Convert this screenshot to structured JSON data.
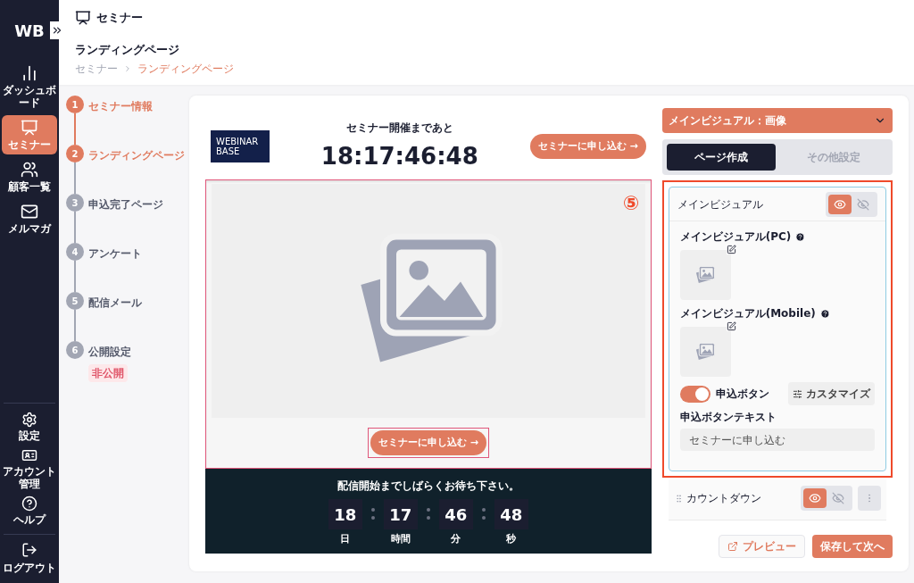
{
  "sidebar": {
    "logo": "WB",
    "items": [
      {
        "label": "ダッシュボード",
        "selected": false
      },
      {
        "label": "セミナー",
        "selected": true
      },
      {
        "label": "顧客一覧",
        "selected": false
      },
      {
        "label": "メルマガ",
        "selected": false
      }
    ],
    "bottom_items": [
      {
        "label": "設定"
      },
      {
        "label": "アカウント管理"
      },
      {
        "label": "ヘルプ"
      }
    ],
    "logout": "ログアウト"
  },
  "header": {
    "title": "セミナー",
    "page_title": "ランディングページ",
    "breadcrumb": [
      "セミナー",
      "ランディングページ"
    ]
  },
  "steps": [
    {
      "number": "1",
      "label": "セミナー情報",
      "active": true
    },
    {
      "number": "2",
      "label": "ランディングページ",
      "active": true
    },
    {
      "number": "3",
      "label": "申込完了ページ",
      "active": false
    },
    {
      "number": "4",
      "label": "アンケート",
      "active": false
    },
    {
      "number": "5",
      "label": "配信メール",
      "active": false
    },
    {
      "number": "6",
      "label": "公開設定",
      "active": false,
      "badge": "非公開"
    }
  ],
  "preview": {
    "logo": [
      "WEBINAR",
      "BASE"
    ],
    "countdown_heading": "セミナー開催まであと",
    "countdown": "18:17:46:48",
    "cta_top": "セミナーに申し込む →",
    "cta_bottom": "セミナーに申し込む →",
    "banner_heading": "配信開始までしばらくお待ち下さい。",
    "timer": [
      {
        "value": "18",
        "unit": "日"
      },
      {
        "value": "17",
        "unit": "時間"
      },
      {
        "value": "46",
        "unit": "分"
      },
      {
        "value": "48",
        "unit": "秒"
      }
    ]
  },
  "panel": {
    "section_select": "メインビジュアル：画像",
    "tabs": [
      {
        "label": "ページ作成",
        "selected": true
      },
      {
        "label": "その他設定",
        "selected": false
      }
    ],
    "annotation": "⑤",
    "main_visual": {
      "title": "メインビジュアル",
      "visible": true,
      "images": [
        {
          "label": "メインビジュアル(PC)"
        },
        {
          "label": "メインビジュアル(Mobile)"
        }
      ],
      "toggle": {
        "label": "申込ボタン",
        "on": true
      },
      "customize": "カスタマイズ",
      "text_label": "申込ボタンテキスト",
      "text_value": "セミナーに申し込む"
    },
    "countdown_block": {
      "title": "カウントダウン",
      "visible": true
    },
    "preview_button": "プレビュー",
    "save_button": "保存して次へ"
  }
}
